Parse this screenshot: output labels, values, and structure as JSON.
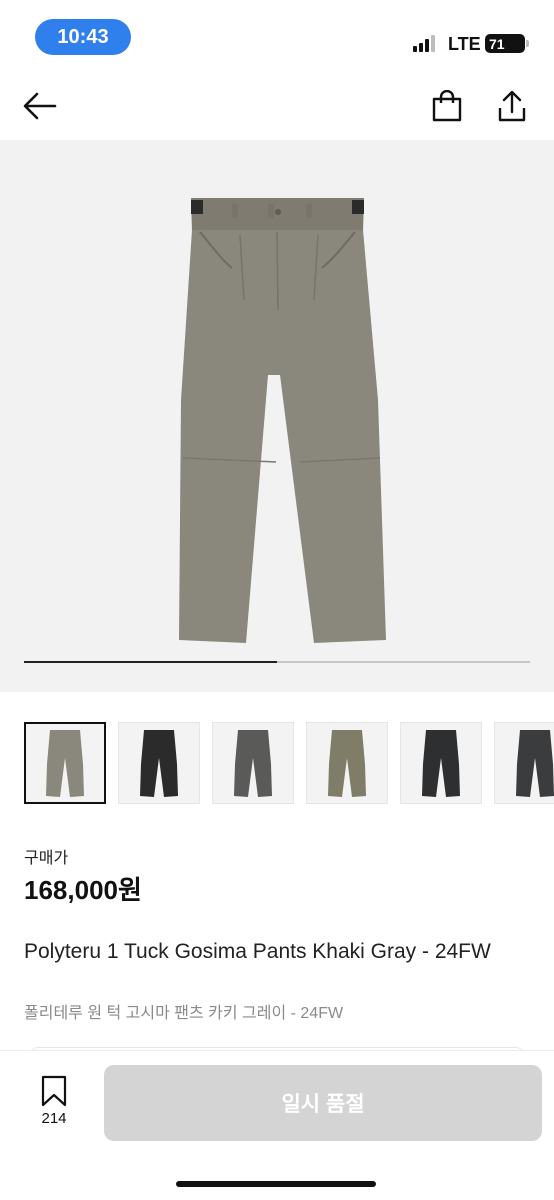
{
  "status_bar": {
    "time": "10:43",
    "network": "LTE",
    "battery": "71"
  },
  "nav": {
    "back_icon": "arrow-left-icon",
    "bag_icon": "shopping-bag-icon",
    "share_icon": "share-icon"
  },
  "hero": {
    "product_color": "#8a877c",
    "carousel_progress_fraction": 0.5
  },
  "thumbnails": [
    {
      "name": "khaki-gray",
      "color": "#8a877c",
      "selected": true
    },
    {
      "name": "black",
      "color": "#2b2b2b",
      "selected": false
    },
    {
      "name": "charcoal",
      "color": "#5a5a58",
      "selected": false
    },
    {
      "name": "khaki",
      "color": "#7f7d68",
      "selected": false
    },
    {
      "name": "black-2",
      "color": "#2e2f31",
      "selected": false
    },
    {
      "name": "dark-gray",
      "color": "#3b3c3e",
      "selected": false
    }
  ],
  "product": {
    "price_label": "구매가",
    "price": "168,000원",
    "title_en": "Polyteru 1 Tuck Gosima Pants Khaki Gray - 24FW",
    "title_ko": "폴리테루 원 턱 고시마 팬츠 카키 그레이 - 24FW"
  },
  "bottom_bar": {
    "bookmark_count": "214",
    "soldout_label": "일시 품절"
  }
}
